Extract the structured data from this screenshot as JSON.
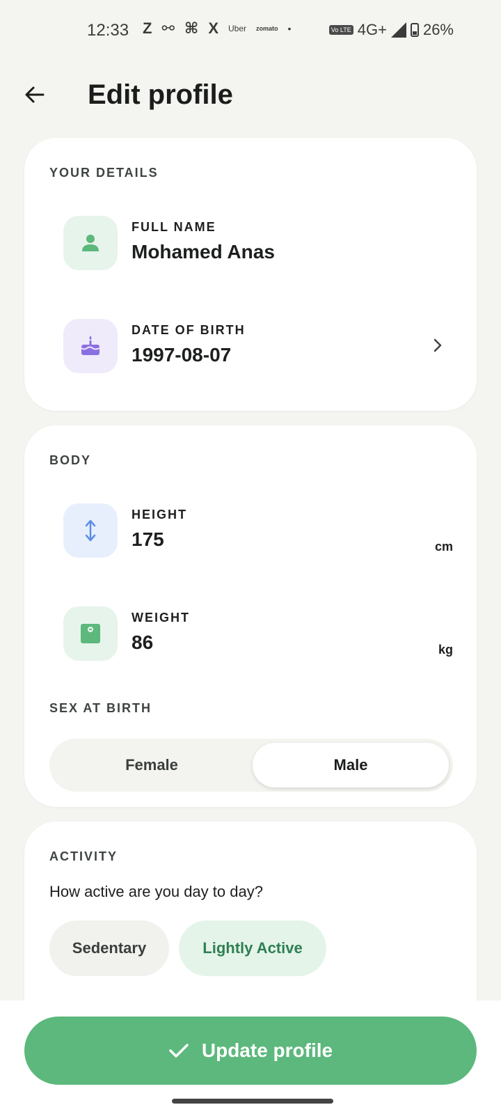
{
  "status_bar": {
    "time": "12:33",
    "app_icons": [
      "Z",
      "⚯",
      "⌘",
      "X",
      "Uber",
      "zomato",
      "•"
    ],
    "volte": "Vo LTE",
    "network": "4G+",
    "battery": "26%"
  },
  "header": {
    "back_icon": "arrow-left-icon",
    "title": "Edit profile"
  },
  "details": {
    "section_label": "YOUR DETAILS",
    "full_name_label": "FULL NAME",
    "full_name_value": "Mohamed Anas",
    "dob_label": "DATE OF BIRTH",
    "dob_value": "1997-08-07"
  },
  "body": {
    "section_label": "BODY",
    "height_label": "HEIGHT",
    "height_value": "175",
    "height_unit": "cm",
    "weight_label": "WEIGHT",
    "weight_value": "86",
    "weight_unit": "kg",
    "sex_label": "SEX AT BIRTH",
    "sex_options": [
      "Female",
      "Male"
    ],
    "sex_selected": "Male"
  },
  "activity": {
    "section_label": "ACTIVITY",
    "question": "How active are you day to day?",
    "options": [
      "Sedentary",
      "Lightly Active"
    ],
    "selected": "Lightly Active"
  },
  "footer": {
    "update_label": "Update profile"
  },
  "colors": {
    "accent_green": "#5cb87c",
    "background": "#f4f4f0",
    "card": "#ffffff"
  }
}
